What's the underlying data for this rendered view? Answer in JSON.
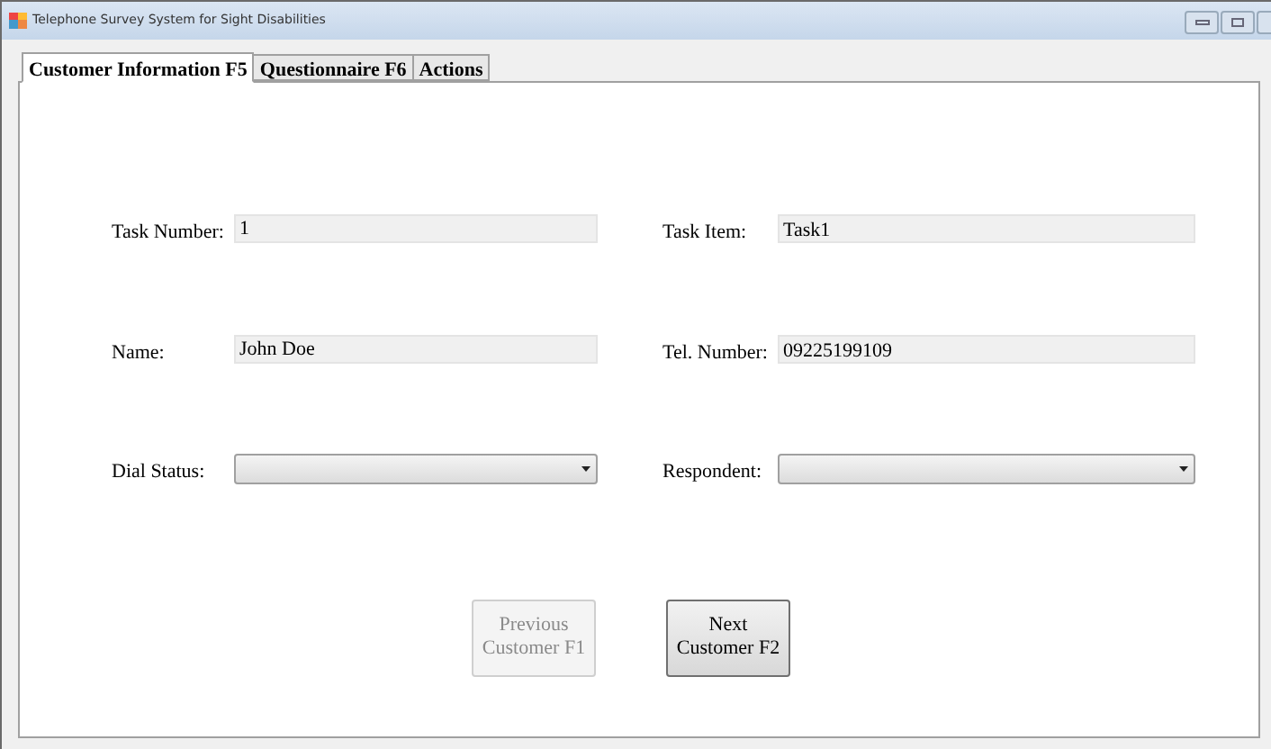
{
  "window": {
    "title": "Telephone Survey System for Sight Disabilities"
  },
  "tabs": [
    {
      "label": "Customer Information F5",
      "selected": true
    },
    {
      "label": "Questionnaire F6",
      "selected": false
    },
    {
      "label": "Actions",
      "selected": false
    }
  ],
  "fields": [
    {
      "kind": "text",
      "label": "Task Number:",
      "value": "1"
    },
    {
      "kind": "text",
      "label": "Task Item:",
      "value": "Task1"
    },
    {
      "kind": "text",
      "label": "Name:",
      "value": "John Doe"
    },
    {
      "kind": "text",
      "label": "Tel. Number:",
      "value": "09225199109"
    },
    {
      "kind": "combo",
      "label": "Dial Status:"
    },
    {
      "kind": "combo",
      "label": "Respondent:"
    }
  ],
  "buttons": [
    {
      "line1": "Previous",
      "line2": "Customer F1",
      "disabled": true
    },
    {
      "line1": "Next",
      "line2": "Customer F2",
      "disabled": false
    }
  ]
}
